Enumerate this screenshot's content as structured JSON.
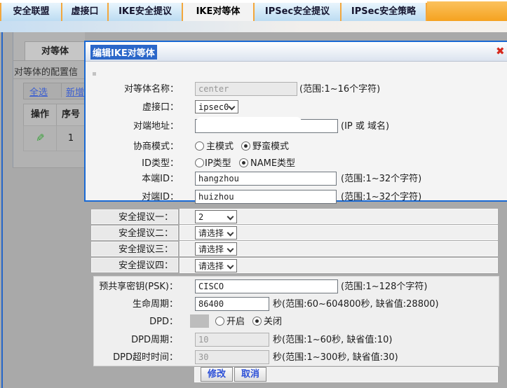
{
  "tabs": {
    "items": [
      {
        "label": "安全联盟",
        "active": false
      },
      {
        "label": "虚接口",
        "active": false
      },
      {
        "label": "IKE安全提议",
        "active": false
      },
      {
        "label": "IKE对等体",
        "active": true
      },
      {
        "label": "IPSec安全提议",
        "active": false
      },
      {
        "label": "IPSec安全策略",
        "active": false
      }
    ]
  },
  "background": {
    "panel_tab": "对等体",
    "description": "对等体的配置信",
    "select_all": "全选",
    "add_new": "新增",
    "col_op": "操作",
    "col_seq": "序号",
    "row_seq": "1"
  },
  "dialog": {
    "title": "编辑IKE对等体",
    "close": "✖",
    "peer_name": {
      "label": "对等体名称：",
      "value": "center",
      "hint": "(范围:1~16个字符)",
      "disabled": true
    },
    "vif": {
      "label": "虚接口：",
      "value": "ipsec0"
    },
    "peer_addr": {
      "label": "对端地址：",
      "value": "",
      "hint": "(IP 或 域名)",
      "redacted": true
    },
    "mode": {
      "label": "协商模式：",
      "opt1": "主模式",
      "opt2": "野蛮模式",
      "selected": "野蛮模式"
    },
    "id_type": {
      "label": "ID类型：",
      "opt1": "IP类型",
      "opt2": "NAME类型",
      "selected": "NAME类型"
    },
    "local_id": {
      "label": "本端ID：",
      "value": "hangzhou",
      "hint": "(范围:1~32个字符)"
    },
    "peer_id": {
      "label": "对端ID：",
      "value": "huizhou",
      "hint": "(范围:1~32个字符)"
    }
  },
  "proposals": [
    {
      "label": "安全提议一：",
      "value": "2"
    },
    {
      "label": "安全提议二：",
      "value": "请选择"
    },
    {
      "label": "安全提议三：",
      "value": "请选择"
    },
    {
      "label": "安全提议四：",
      "value": "请选择"
    }
  ],
  "advanced": {
    "psk": {
      "label": "预共享密钥(PSK)：",
      "value": "CISCO",
      "hint": "(范围:1~128个字符)"
    },
    "lifetime": {
      "label": "生命周期：",
      "value": "86400",
      "hint": "秒(范围:60~604800秒, 缺省值:28800)"
    },
    "dpd": {
      "label": "DPD：",
      "opt1": "开启",
      "opt2": "关闭",
      "selected": "关闭"
    },
    "dpd_interval": {
      "label": "DPD周期：",
      "value": "10",
      "hint": "秒(范围:1~60秒, 缺省值:10)",
      "disabled": true
    },
    "dpd_timeout": {
      "label": "DPD超时时间：",
      "value": "30",
      "hint": "秒(范围:1~300秒, 缺省值:30)",
      "disabled": true
    }
  },
  "actions": {
    "modify": "修改",
    "cancel": "取消"
  },
  "colors": {
    "accent_blue": "#1969d4",
    "tab_orange": "#f5a21f",
    "tab_blue": "#bcdcf2",
    "link_blue": "#2b4fd7",
    "close_red": "#d6281c",
    "overlay_gray": "#a9a9a9"
  }
}
